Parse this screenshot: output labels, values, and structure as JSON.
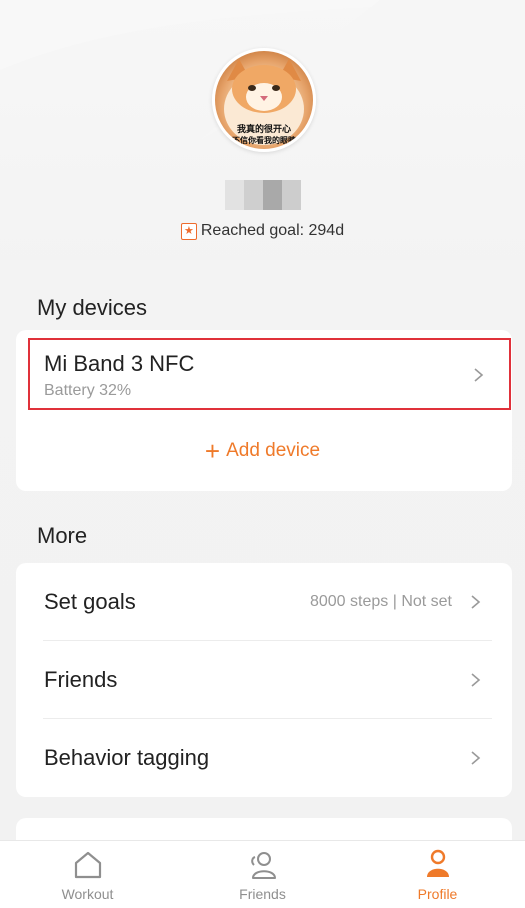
{
  "profile": {
    "avatar_caption_line1": "我真的很开心",
    "avatar_caption_line2": "不信你看我的眼睛",
    "goal_icon": "star-badge-icon",
    "goal_text": "Reached goal: 294d"
  },
  "devices": {
    "section_title": "My devices",
    "items": [
      {
        "name": "Mi Band 3 NFC",
        "status": "Battery 32%"
      }
    ],
    "add_label": "Add device"
  },
  "more": {
    "section_title": "More",
    "items": [
      {
        "label": "Set goals",
        "value": "8000 steps | Not set"
      },
      {
        "label": "Friends",
        "value": ""
      },
      {
        "label": "Behavior tagging",
        "value": ""
      }
    ]
  },
  "tabbar": {
    "tabs": [
      {
        "label": "Workout",
        "icon": "home-icon",
        "active": false
      },
      {
        "label": "Friends",
        "icon": "friends-icon",
        "active": false
      },
      {
        "label": "Profile",
        "icon": "profile-icon",
        "active": true
      }
    ]
  },
  "colors": {
    "accent": "#ef7a2a",
    "highlight_border": "#e0313a",
    "background": "#f3f3f3"
  }
}
